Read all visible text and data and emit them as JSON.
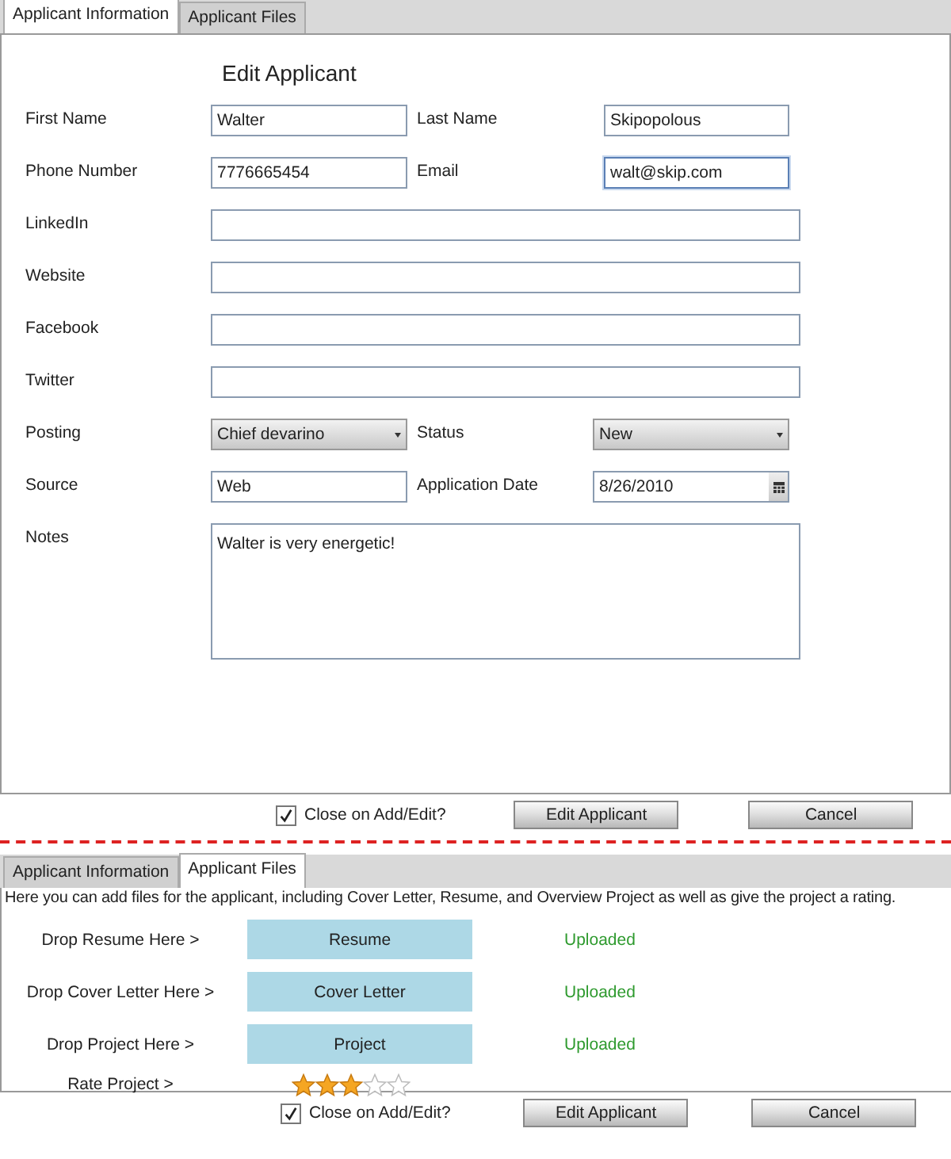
{
  "info_panel": {
    "tabs": [
      {
        "label": "Applicant Information",
        "selected": true
      },
      {
        "label": "Applicant Files",
        "selected": false
      }
    ],
    "title": "Edit Applicant",
    "rows": [
      [
        {
          "label": "First Name",
          "kind": "text",
          "value": "Walter",
          "focused": false
        },
        {
          "label": "Last Name",
          "kind": "text",
          "value": "Skipopolous",
          "focused": false
        }
      ],
      [
        {
          "label": "Phone Number",
          "kind": "text",
          "value": "7776665454",
          "focused": false
        },
        {
          "label": "Email",
          "kind": "text",
          "value": "walt@skip.com",
          "focused": true
        }
      ],
      [
        {
          "label": "LinkedIn",
          "kind": "text",
          "focused": false
        }
      ],
      [
        {
          "label": "Website",
          "kind": "text",
          "focused": false
        }
      ],
      [
        {
          "label": "Facebook",
          "kind": "text",
          "focused": false
        }
      ],
      [
        {
          "label": "Twitter",
          "kind": "text",
          "focused": false
        }
      ],
      [
        {
          "label": "Posting",
          "kind": "select",
          "value": "Chief devarino"
        },
        {
          "label": "Status",
          "kind": "select",
          "value": "New"
        }
      ],
      [
        {
          "label": "Source",
          "kind": "text",
          "value": "Web",
          "focused": false
        },
        {
          "label": "Application Date",
          "kind": "date",
          "value": "8/26/2010"
        }
      ],
      [
        {
          "label": "Notes",
          "kind": "textarea",
          "value": "Walter is very energetic!"
        }
      ]
    ],
    "footer": {
      "checkbox": {
        "label": "Close on Add/Edit?",
        "checked": true
      },
      "buttons": [
        "Edit Applicant",
        "Cancel"
      ]
    }
  },
  "files_panel": {
    "tabs": [
      {
        "label": "Applicant Information",
        "selected": false
      },
      {
        "label": "Applicant Files",
        "selected": true
      }
    ],
    "description": "Here you can add files for the applicant, including Cover Letter, Resume, and Overview Project as well as give the project a rating.",
    "files": [
      {
        "label": "Drop Resume Here >",
        "button": "Resume",
        "status": "Uploaded"
      },
      {
        "label": "Drop Cover Letter Here >",
        "button": "Cover Letter",
        "status": "Uploaded"
      },
      {
        "label": "Drop Project Here >",
        "button": "Project",
        "status": "Uploaded"
      }
    ],
    "rating": {
      "label": "Rate Project >",
      "stars": 3
    },
    "footer": {
      "checkbox": {
        "label": "Close on Add/Edit?",
        "checked": true
      },
      "buttons": [
        "Edit Applicant",
        "Cancel"
      ]
    }
  }
}
